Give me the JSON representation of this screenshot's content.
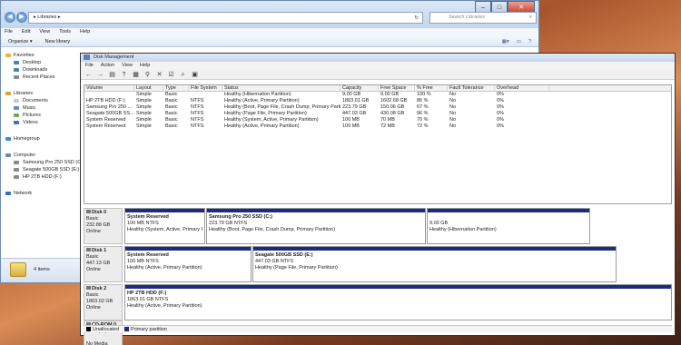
{
  "explorer": {
    "address": "▸ Libraries ▸",
    "search_placeholder": "Search Libraries",
    "menu": [
      "File",
      "Edit",
      "View",
      "Tools",
      "Help"
    ],
    "toolbar": {
      "organize": "Organize ▾",
      "new_library": "New library"
    },
    "nav": {
      "favorites": "Favorites",
      "favorites_items": [
        "Desktop",
        "Downloads",
        "Recent Places"
      ],
      "libraries": "Libraries",
      "libraries_items": [
        "Documents",
        "Music",
        "Pictures",
        "Videos"
      ],
      "homegroup": "Homegroup",
      "computer": "Computer",
      "computer_items": [
        "Samsung Pro 250 SSD (C:)",
        "Seagate 500GB SSD (E:)",
        "HP 2TB HDD  (F:)"
      ],
      "network": "Network"
    },
    "status": "4 items"
  },
  "dm": {
    "title": "Disk Management",
    "menu": [
      "File",
      "Action",
      "View",
      "Help"
    ],
    "columns": [
      "Volume",
      "Layout",
      "Type",
      "File System",
      "Status",
      "Capacity",
      "Free Space",
      "% Free",
      "Fault Tolerance",
      "Overhead"
    ],
    "rows": [
      [
        "",
        "Simple",
        "Basic",
        "",
        "Healthy (Hibernation Partition)",
        "9.00 GB",
        "9.00 GB",
        "100 %",
        "No",
        "0%"
      ],
      [
        "HP 2TB HDD  (F:)",
        "Simple",
        "Basic",
        "NTFS",
        "Healthy (Active, Primary Partition)",
        "1863.01 GB",
        "1602.68 GB",
        "86 %",
        "No",
        "0%"
      ],
      [
        "Samsung Pro 250 ...",
        "Simple",
        "Basic",
        "NTFS",
        "Healthy (Boot, Page File, Crash Dump, Primary Partition)",
        "223.79 GB",
        "150.06 GB",
        "67 %",
        "No",
        "0%"
      ],
      [
        "Seagate 500GB SS...",
        "Simple",
        "Basic",
        "NTFS",
        "Healthy (Page File, Primary Partition)",
        "447.03 GB",
        "430.08 GB",
        "96 %",
        "No",
        "0%"
      ],
      [
        "System Reserved",
        "Simple",
        "Basic",
        "NTFS",
        "Healthy (System, Active, Primary Partition)",
        "100 MB",
        "70 MB",
        "70 %",
        "No",
        "0%"
      ],
      [
        "System Reserved",
        "Simple",
        "Basic",
        "NTFS",
        "Healthy (Active, Primary Partition)",
        "100 MB",
        "72 MB",
        "72 %",
        "No",
        "0%"
      ]
    ],
    "disks": [
      {
        "name": "Disk 0",
        "type": "Basic",
        "size": "232.88 GB",
        "state": "Online",
        "parts": [
          {
            "name": "System Reserved",
            "info": "100 MB NTFS",
            "status": "Healthy (System, Active, Primary Partit"
          },
          {
            "name": "Samsung Pro 250 SSD  (C:)",
            "info": "223.79 GB NTFS",
            "status": "Healthy (Boot, Page File, Crash Dump, Primary Partition)"
          },
          {
            "name": "",
            "info": "9.00 GB",
            "status": "Healthy (Hibernation Partition)"
          }
        ]
      },
      {
        "name": "Disk 1",
        "type": "Basic",
        "size": "447.13 GB",
        "state": "Online",
        "parts": [
          {
            "name": "System Reserved",
            "info": "100 MB NTFS",
            "status": "Healthy (Active, Primary Partition)"
          },
          {
            "name": "Seagate 500GB SSD  (E:)",
            "info": "447.03 GB NTFS",
            "status": "Healthy (Page File, Primary Partition)"
          }
        ]
      },
      {
        "name": "Disk 2",
        "type": "Basic",
        "size": "1863.02 GB",
        "state": "Online",
        "parts": [
          {
            "name": "HP 2TB HDD   (F:)",
            "info": "1863.01 GB NTFS",
            "status": "Healthy (Active, Primary Partition)"
          }
        ]
      },
      {
        "name": "CD-ROM 0",
        "type": "DVD (D:)",
        "size": "",
        "state": "No Media",
        "parts": []
      }
    ],
    "legend": {
      "unallocated": "Unallocated",
      "primary": "Primary partition",
      "unallocated_color": "#000000",
      "primary_color": "#1c2b82"
    }
  }
}
